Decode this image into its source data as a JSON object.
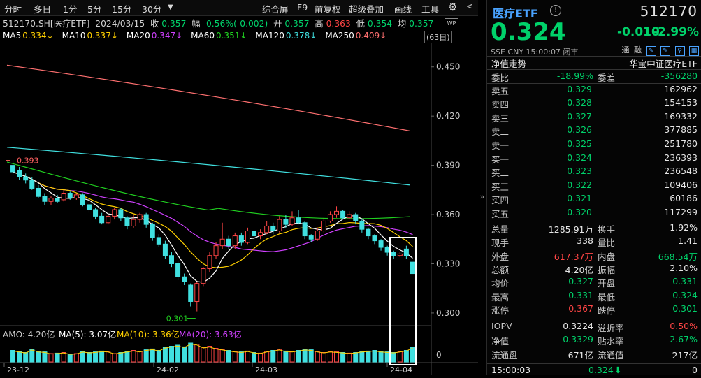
{
  "toolbar": {
    "left": [
      "分时",
      "多日",
      "1分",
      "5分",
      "15分",
      "30分"
    ],
    "right": [
      "综合屏",
      "F9",
      "前复权",
      "超级叠加",
      "画线",
      "工具"
    ]
  },
  "info": {
    "code": "512170.SH[医疗ETF]",
    "date": "2024/03/15",
    "close_label": "收",
    "close": "0.357",
    "chg_label": "幅",
    "chg": "-0.56%(-0.002)",
    "open_label": "开",
    "open": "0.357",
    "high_label": "高",
    "high": "0.363",
    "low_label": "低",
    "low": "0.354",
    "avg_label": "均",
    "avg": "0.357"
  },
  "ma": [
    {
      "label": "MA5",
      "value": "0.334↓",
      "color": "#ffffff",
      "vcolor": "#ffd000"
    },
    {
      "label": "MA10",
      "value": "0.337↓",
      "color": "#ffffff",
      "vcolor": "#ffd000"
    },
    {
      "label": "MA20",
      "value": "0.347↓",
      "color": "#ffffff",
      "vcolor": "#d040ff"
    },
    {
      "label": "MA60",
      "value": "0.351↓",
      "color": "#ffffff",
      "vcolor": "#20d020"
    },
    {
      "label": "MA120",
      "value": "0.378↓",
      "color": "#ffffff",
      "vcolor": "#40e0e0"
    },
    {
      "label": "MA250",
      "value": "0.409↓",
      "color": "#ffffff",
      "vcolor": "#ff7070"
    }
  ],
  "days_label": "(63日)",
  "wp_label": "WP",
  "yaxis": [
    "0.450",
    "0.420",
    "0.390",
    "0.360",
    "0.330",
    "0.300"
  ],
  "marks": {
    "high": "0.393",
    "low": "0.301"
  },
  "amo": {
    "label": "AMO: 4.20亿",
    "ma5": "MA(5): 3.07亿",
    "ma10": "MA(10): 3.36亿",
    "ma20": "MA(20): 3.63亿",
    "zero": "0"
  },
  "xaxis": [
    "23-12",
    "24-02",
    "24-03",
    "24-04"
  ],
  "panel": {
    "name": "医疗ETF",
    "code": "512170",
    "price": "0.324",
    "change": "-0.010",
    "pct": "-2.99%",
    "sub": "SSE  CNY  15:00:07  闭市",
    "icons": [
      "通",
      "融"
    ],
    "trend_label": "净值走势",
    "fund_name": "华宝中证医疗ETF",
    "weibi_label": "委比",
    "weibi": "-18.99%",
    "weicha_label": "委差",
    "weicha": "-356280",
    "asks": [
      {
        "label": "卖五",
        "price": "0.329",
        "vol": "162962"
      },
      {
        "label": "卖四",
        "price": "0.328",
        "vol": "154153"
      },
      {
        "label": "卖三",
        "price": "0.327",
        "vol": "169332"
      },
      {
        "label": "卖二",
        "price": "0.326",
        "vol": "377885"
      },
      {
        "label": "卖一",
        "price": "0.325",
        "vol": "251780"
      }
    ],
    "bids": [
      {
        "label": "买一",
        "price": "0.324",
        "vol": "236393"
      },
      {
        "label": "买二",
        "price": "0.323",
        "vol": "236548"
      },
      {
        "label": "买三",
        "price": "0.322",
        "vol": "109406"
      },
      {
        "label": "买四",
        "price": "0.321",
        "vol": "60186"
      },
      {
        "label": "买五",
        "price": "0.320",
        "vol": "117299"
      }
    ],
    "stats": [
      [
        {
          "l": "总量",
          "v": "1285.91万",
          "c": "w"
        },
        {
          "l": "换手",
          "v": "1.92%",
          "c": "w"
        }
      ],
      [
        {
          "l": "现手",
          "v": "338",
          "c": "w"
        },
        {
          "l": "量比",
          "v": "1.41",
          "c": "w"
        }
      ],
      [
        {
          "l": "外盘",
          "v": "617.37万",
          "c": "r"
        },
        {
          "l": "内盘",
          "v": "668.54万",
          "c": "g"
        }
      ],
      [
        {
          "l": "总额",
          "v": "4.20亿",
          "c": "w"
        },
        {
          "l": "振幅",
          "v": "2.10%",
          "c": "w"
        }
      ],
      [
        {
          "l": "均价",
          "v": "0.327",
          "c": "g"
        },
        {
          "l": "开盘",
          "v": "0.331",
          "c": "g"
        }
      ],
      [
        {
          "l": "最高",
          "v": "0.331",
          "c": "g"
        },
        {
          "l": "最低",
          "v": "0.324",
          "c": "g"
        }
      ],
      [
        {
          "l": "涨停",
          "v": "0.367",
          "c": "r"
        },
        {
          "l": "跌停",
          "v": "0.301",
          "c": "g"
        }
      ]
    ],
    "stats2": [
      [
        {
          "l": "IOPV",
          "v": "0.3224",
          "c": "w"
        },
        {
          "l": "溢折率",
          "v": "0.50%",
          "c": "r"
        }
      ],
      [
        {
          "l": "净值",
          "v": "0.3329",
          "c": "g"
        },
        {
          "l": "贴水率",
          "v": "-2.67%",
          "c": "g"
        }
      ],
      [
        {
          "l": "流通盘",
          "v": "671亿",
          "c": "w"
        },
        {
          "l": "流通值",
          "v": "217亿",
          "c": "w"
        }
      ]
    ],
    "tick": {
      "time": "15:00:03",
      "price": "0.324",
      "vol": "0"
    }
  },
  "candles": [
    [
      0.39,
      0.386,
      0.393,
      0.384
    ],
    [
      0.387,
      0.383,
      0.389,
      0.381
    ],
    [
      0.383,
      0.381,
      0.385,
      0.379
    ],
    [
      0.381,
      0.376,
      0.383,
      0.375
    ],
    [
      0.376,
      0.371,
      0.378,
      0.37
    ],
    [
      0.371,
      0.368,
      0.373,
      0.366
    ],
    [
      0.368,
      0.37,
      0.371,
      0.366
    ],
    [
      0.37,
      0.368,
      0.372,
      0.367
    ],
    [
      0.369,
      0.373,
      0.375,
      0.368
    ],
    [
      0.373,
      0.37,
      0.374,
      0.369
    ],
    [
      0.37,
      0.372,
      0.373,
      0.369
    ],
    [
      0.372,
      0.366,
      0.373,
      0.365
    ],
    [
      0.366,
      0.363,
      0.367,
      0.361
    ],
    [
      0.363,
      0.359,
      0.364,
      0.357
    ],
    [
      0.359,
      0.355,
      0.361,
      0.354
    ],
    [
      0.355,
      0.359,
      0.36,
      0.354
    ],
    [
      0.359,
      0.363,
      0.364,
      0.357
    ],
    [
      0.363,
      0.358,
      0.364,
      0.356
    ],
    [
      0.358,
      0.353,
      0.359,
      0.351
    ],
    [
      0.353,
      0.357,
      0.36,
      0.352
    ],
    [
      0.357,
      0.36,
      0.361,
      0.355
    ],
    [
      0.36,
      0.354,
      0.361,
      0.352
    ],
    [
      0.354,
      0.346,
      0.355,
      0.344
    ],
    [
      0.346,
      0.342,
      0.348,
      0.34
    ],
    [
      0.342,
      0.335,
      0.344,
      0.333
    ],
    [
      0.335,
      0.33,
      0.337,
      0.328
    ],
    [
      0.33,
      0.322,
      0.332,
      0.32
    ],
    [
      0.322,
      0.319,
      0.324,
      0.317
    ],
    [
      0.317,
      0.307,
      0.318,
      0.304
    ],
    [
      0.307,
      0.318,
      0.319,
      0.301
    ],
    [
      0.318,
      0.327,
      0.328,
      0.316
    ],
    [
      0.327,
      0.335,
      0.337,
      0.325
    ],
    [
      0.335,
      0.341,
      0.343,
      0.333
    ],
    [
      0.341,
      0.345,
      0.355,
      0.339
    ],
    [
      0.345,
      0.341,
      0.347,
      0.339
    ],
    [
      0.341,
      0.347,
      0.349,
      0.339
    ],
    [
      0.347,
      0.343,
      0.349,
      0.341
    ],
    [
      0.343,
      0.35,
      0.352,
      0.342
    ],
    [
      0.35,
      0.347,
      0.352,
      0.346
    ],
    [
      0.347,
      0.349,
      0.351,
      0.345
    ],
    [
      0.349,
      0.353,
      0.356,
      0.348
    ],
    [
      0.353,
      0.35,
      0.355,
      0.348
    ],
    [
      0.35,
      0.357,
      0.359,
      0.349
    ],
    [
      0.357,
      0.354,
      0.36,
      0.352
    ],
    [
      0.354,
      0.358,
      0.362,
      0.353
    ],
    [
      0.358,
      0.355,
      0.363,
      0.354
    ],
    [
      0.355,
      0.347,
      0.356,
      0.345
    ],
    [
      0.347,
      0.345,
      0.348,
      0.343
    ],
    [
      0.345,
      0.35,
      0.352,
      0.344
    ],
    [
      0.35,
      0.356,
      0.358,
      0.349
    ],
    [
      0.356,
      0.36,
      0.362,
      0.355
    ],
    [
      0.36,
      0.362,
      0.365,
      0.358
    ],
    [
      0.362,
      0.358,
      0.363,
      0.357
    ],
    [
      0.358,
      0.36,
      0.362,
      0.357
    ],
    [
      0.36,
      0.356,
      0.361,
      0.354
    ],
    [
      0.356,
      0.351,
      0.357,
      0.349
    ],
    [
      0.351,
      0.347,
      0.352,
      0.345
    ],
    [
      0.347,
      0.344,
      0.348,
      0.342
    ],
    [
      0.344,
      0.34,
      0.345,
      0.338
    ],
    [
      0.34,
      0.337,
      0.341,
      0.335
    ],
    [
      0.337,
      0.335,
      0.338,
      0.333
    ],
    [
      0.335,
      0.336,
      0.337,
      0.334
    ],
    [
      0.339,
      0.335,
      0.341,
      0.333
    ],
    [
      0.331,
      0.324,
      0.331,
      0.324
    ]
  ],
  "volumes": [
    0.55,
    0.5,
    0.45,
    0.6,
    0.5,
    0.48,
    0.4,
    0.42,
    0.45,
    0.38,
    0.4,
    0.5,
    0.45,
    0.48,
    0.52,
    0.5,
    0.4,
    0.45,
    0.5,
    0.55,
    0.5,
    0.58,
    0.62,
    0.55,
    0.7,
    0.75,
    0.8,
    0.72,
    0.9,
    0.85,
    0.7,
    0.75,
    0.65,
    0.6,
    0.55,
    0.5,
    0.48,
    0.52,
    0.45,
    0.42,
    0.5,
    0.55,
    0.6,
    0.52,
    0.5,
    0.55,
    0.6,
    0.58,
    0.5,
    0.45,
    0.5,
    0.48,
    0.45,
    0.42,
    0.45,
    0.5,
    0.52,
    0.55,
    0.5,
    0.48,
    0.45,
    0.5,
    0.55,
    0.7
  ]
}
